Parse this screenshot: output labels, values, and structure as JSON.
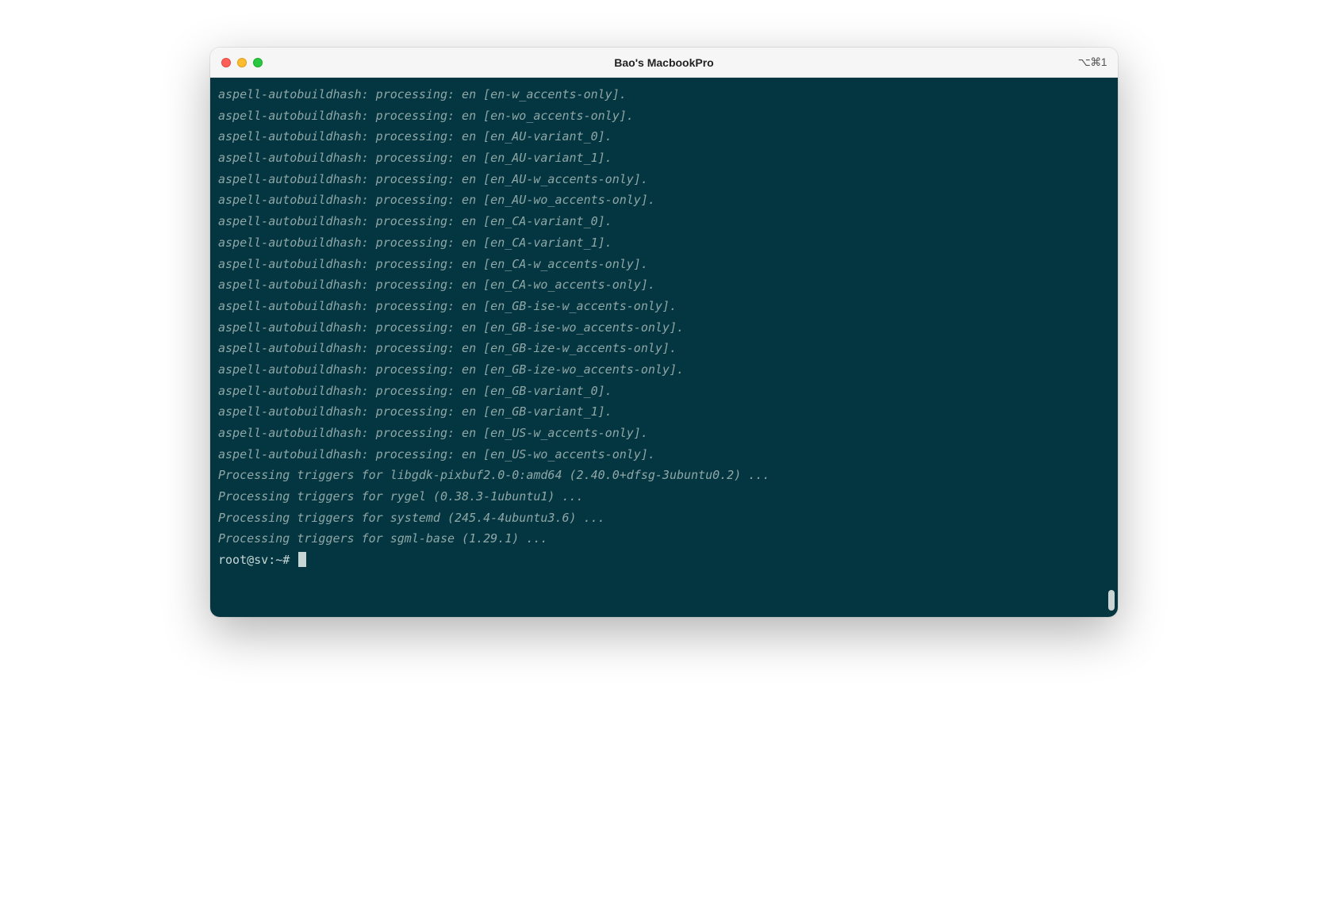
{
  "window": {
    "title": "Bao's MacbookPro",
    "shortcut": "⌥⌘1"
  },
  "terminal": {
    "lines": [
      "aspell-autobuildhash: processing: en [en-w_accents-only].",
      "aspell-autobuildhash: processing: en [en-wo_accents-only].",
      "aspell-autobuildhash: processing: en [en_AU-variant_0].",
      "aspell-autobuildhash: processing: en [en_AU-variant_1].",
      "aspell-autobuildhash: processing: en [en_AU-w_accents-only].",
      "aspell-autobuildhash: processing: en [en_AU-wo_accents-only].",
      "aspell-autobuildhash: processing: en [en_CA-variant_0].",
      "aspell-autobuildhash: processing: en [en_CA-variant_1].",
      "aspell-autobuildhash: processing: en [en_CA-w_accents-only].",
      "aspell-autobuildhash: processing: en [en_CA-wo_accents-only].",
      "aspell-autobuildhash: processing: en [en_GB-ise-w_accents-only].",
      "aspell-autobuildhash: processing: en [en_GB-ise-wo_accents-only].",
      "aspell-autobuildhash: processing: en [en_GB-ize-w_accents-only].",
      "aspell-autobuildhash: processing: en [en_GB-ize-wo_accents-only].",
      "aspell-autobuildhash: processing: en [en_GB-variant_0].",
      "aspell-autobuildhash: processing: en [en_GB-variant_1].",
      "aspell-autobuildhash: processing: en [en_US-w_accents-only].",
      "aspell-autobuildhash: processing: en [en_US-wo_accents-only].",
      "Processing triggers for libgdk-pixbuf2.0-0:amd64 (2.40.0+dfsg-3ubuntu0.2) ...",
      "Processing triggers for rygel (0.38.3-1ubuntu1) ...",
      "Processing triggers for systemd (245.4-4ubuntu3.6) ...",
      "Processing triggers for sgml-base (1.29.1) ..."
    ],
    "prompt": "root@sv:~# "
  }
}
